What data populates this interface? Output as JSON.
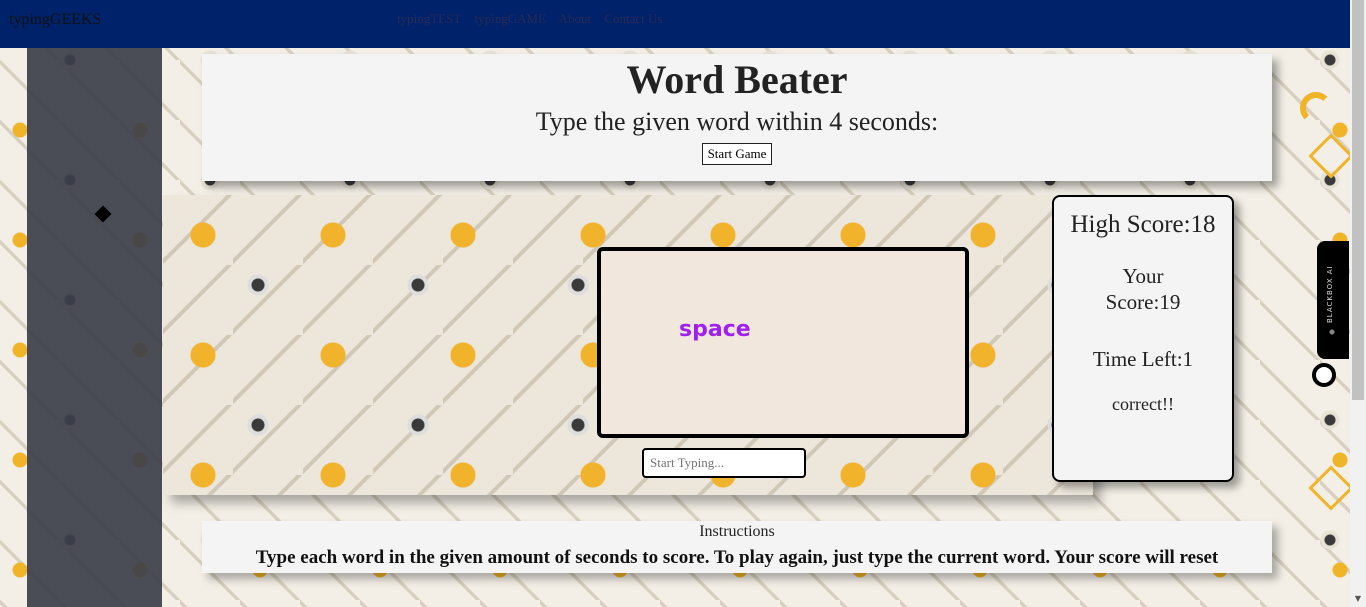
{
  "nav": {
    "brand": "typingGEEKS",
    "links": [
      "typingTEST",
      "typingGAME",
      "About",
      "Contact Us"
    ]
  },
  "header": {
    "title": "Word Beater",
    "subtitle": "Type the given word within 4 seconds:",
    "start_button": "Start Game"
  },
  "game": {
    "current_word": "space",
    "input_placeholder": "Start Typing..."
  },
  "scores": {
    "high_score": "High Score:18",
    "your_score": "Your Score:19",
    "time_left": "Time Left:1",
    "status": "correct!!"
  },
  "instructions": {
    "title": "Instructions",
    "text": "Type each word in the given amount of seconds to score. To play again, just type the current word. Your score will reset"
  },
  "extension_tab": {
    "label": "BLACKBOX AI"
  },
  "colors": {
    "nav_bg": "#00226a",
    "word_color": "#a020f0",
    "accent_yellow": "#f0b429"
  }
}
